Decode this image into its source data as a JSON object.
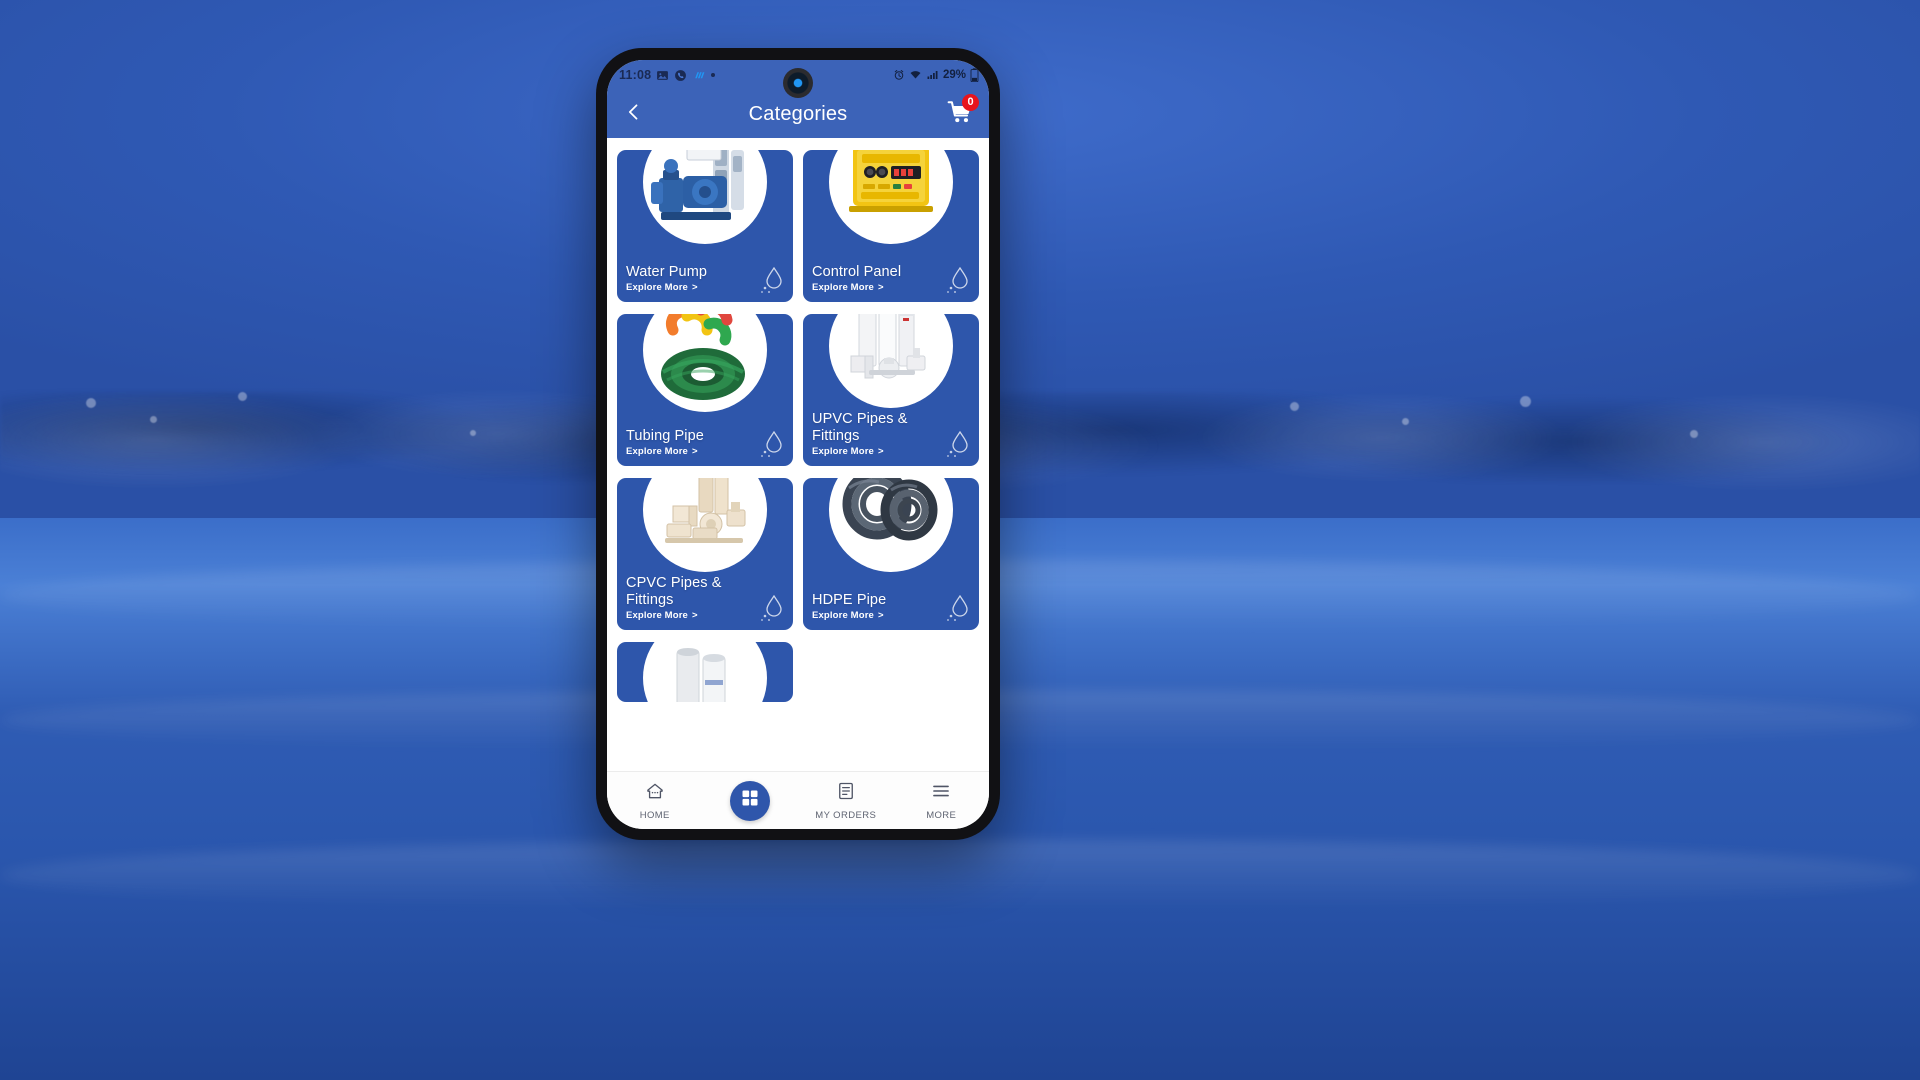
{
  "status_bar": {
    "time": "11:08",
    "left_icons": [
      "image-icon",
      "phone-call-icon",
      "app-icon",
      "dot-icon"
    ],
    "right_icons": [
      "alarm-icon",
      "wifi-icon",
      "signal-icon"
    ],
    "battery_percent": "29%"
  },
  "app_bar": {
    "back_icon": "chevron-left-icon",
    "title": "Categories",
    "cart_icon": "shopping-cart-icon",
    "cart_badge": "0"
  },
  "colors": {
    "brand_blue": "#2e56ab",
    "app_bar_blue": "#3c63b8",
    "badge_red": "#e8141c",
    "card_text": "#ffffff"
  },
  "categories": [
    {
      "title": "Water Pump",
      "cta": "Explore More",
      "chevron": ">",
      "art": "water-pump-art"
    },
    {
      "title": "Control Panel",
      "cta": "Explore More",
      "chevron": ">",
      "art": "control-panel-art"
    },
    {
      "title": "Tubing Pipe",
      "cta": "Explore More",
      "chevron": ">",
      "art": "tubing-pipe-art"
    },
    {
      "title": "UPVC Pipes & Fittings",
      "cta": "Explore More",
      "chevron": ">",
      "art": "upvc-fittings-art"
    },
    {
      "title": "CPVC Pipes & Fittings",
      "cta": "Explore More",
      "chevron": ">",
      "art": "cpvc-fittings-art"
    },
    {
      "title": "HDPE Pipe",
      "cta": "Explore More",
      "chevron": ">",
      "art": "hdpe-pipe-art"
    }
  ],
  "partial_category": {
    "art": "pvc-pipe-art"
  },
  "bottom_nav": {
    "items": [
      {
        "label": "HOME",
        "icon": "home-icon",
        "active": false
      },
      {
        "label": "",
        "icon": "grid-icon",
        "active": true
      },
      {
        "label": "MY ORDERS",
        "icon": "receipt-icon",
        "active": false
      },
      {
        "label": "MORE",
        "icon": "menu-icon",
        "active": false
      }
    ]
  }
}
